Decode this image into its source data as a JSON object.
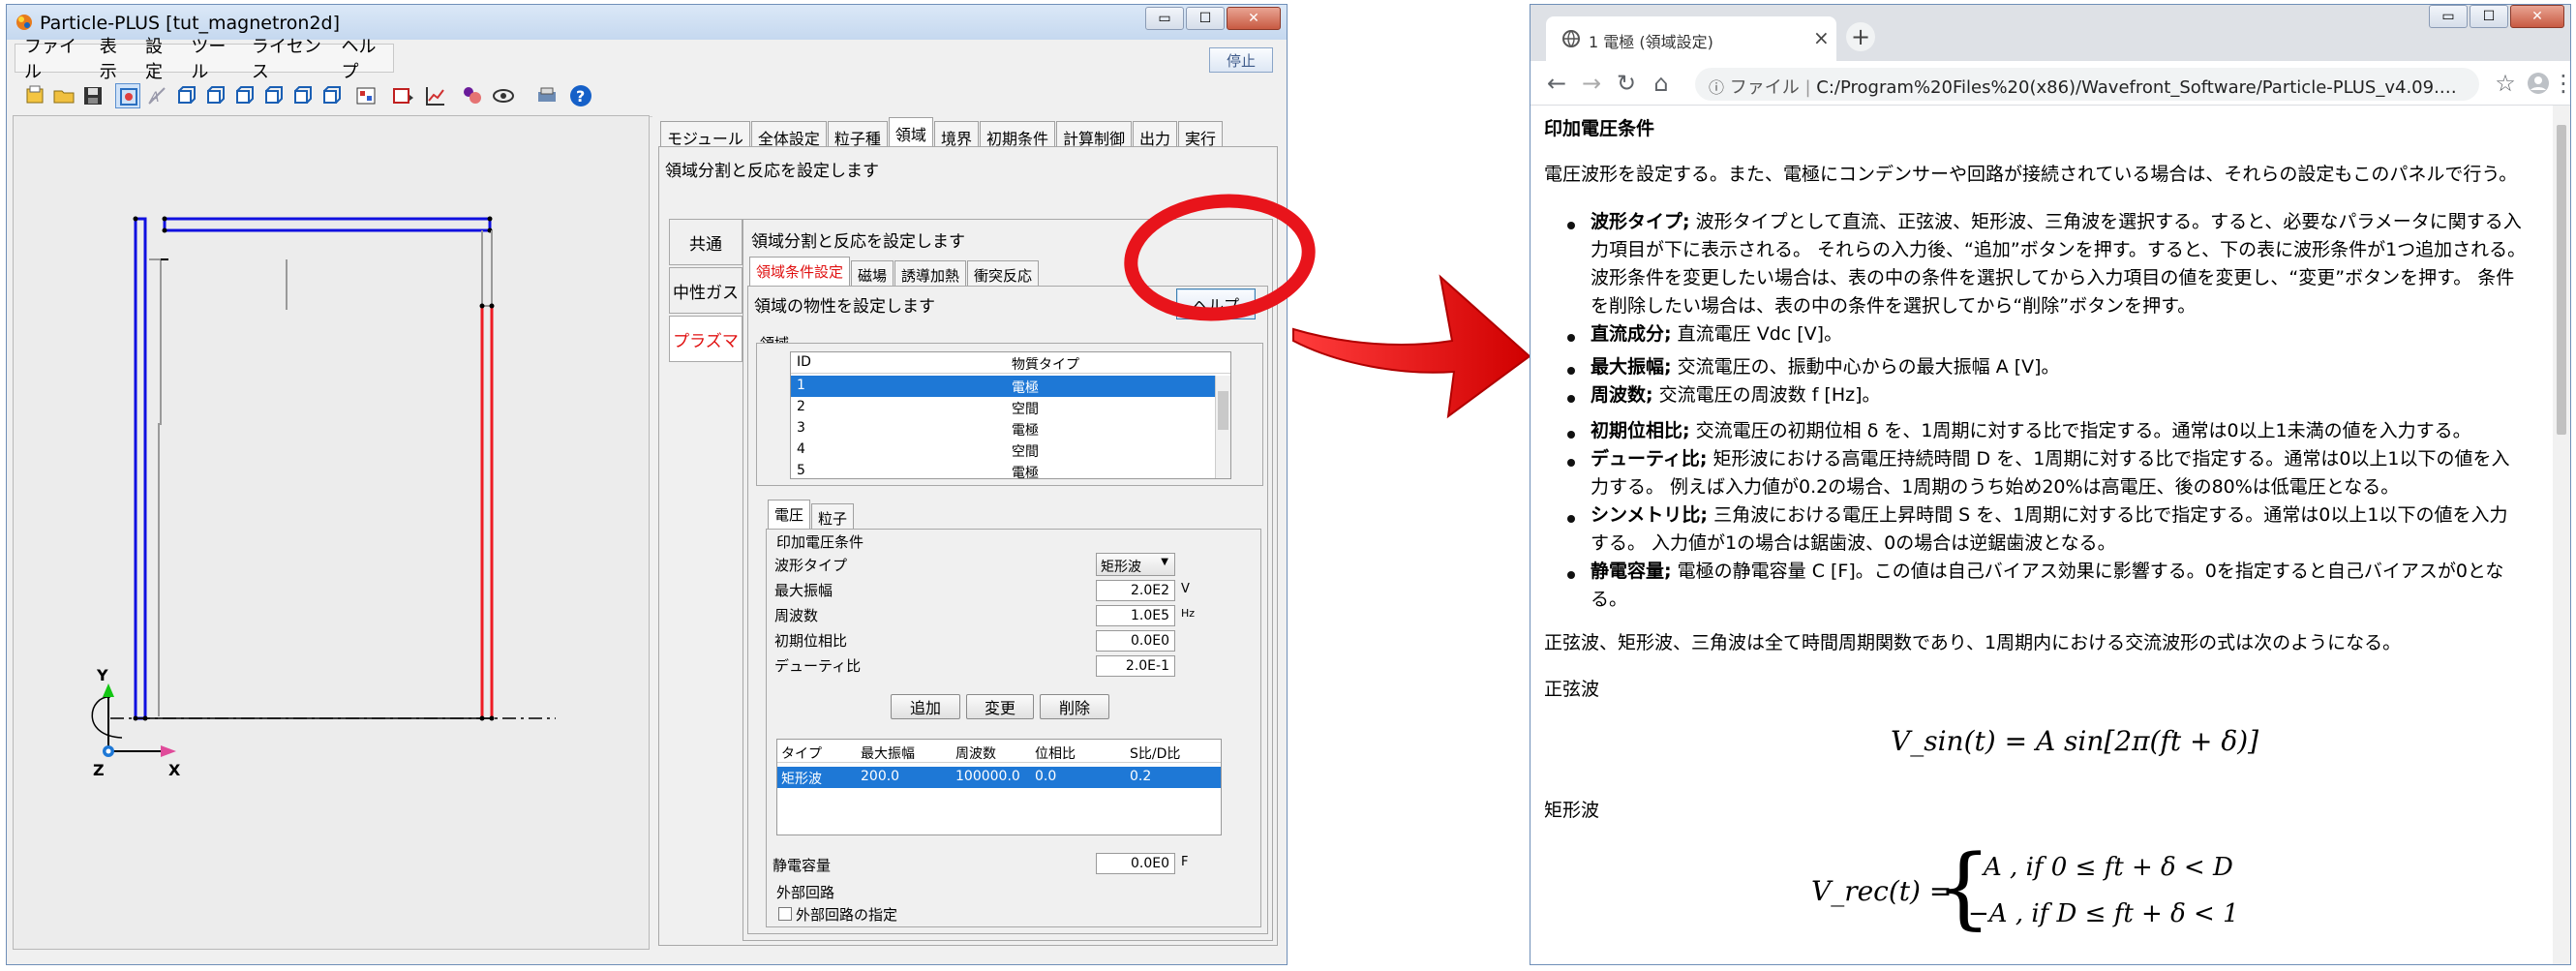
{
  "app": {
    "title": "Particle-PLUS [tut_magnetron2d]",
    "menu": [
      "ファイル",
      "表示",
      "設定",
      "ツール",
      "ライセンス",
      "ヘルプ"
    ],
    "stop_label": "停止",
    "main_tabs": [
      "モジュール",
      "全体設定",
      "粒子種",
      "領域",
      "境界",
      "初期条件",
      "計算制御",
      "出力",
      "実行"
    ],
    "main_heading": "領域分割と反応を設定します",
    "side_tabs": [
      "共通",
      "中性ガス",
      "プラズマ"
    ],
    "sub_heading": "領域分割と反応を設定します",
    "sub_tabs": [
      "領域条件設定",
      "磁場",
      "誘導加熱",
      "衝突反応"
    ],
    "property_heading": "領域の物性を設定します",
    "help_label": "ヘルプ",
    "region_group": "領域",
    "region_table": {
      "headers": [
        "ID",
        "物質タイプ"
      ],
      "rows": [
        [
          "1",
          "電極"
        ],
        [
          "2",
          "空間"
        ],
        [
          "3",
          "電極"
        ],
        [
          "4",
          "空間"
        ],
        [
          "5",
          "電極"
        ]
      ]
    },
    "inner_tabs": [
      "電圧",
      "粒子"
    ],
    "voltage_group": "印加電圧条件",
    "fields": [
      {
        "label": "波形タイプ",
        "value": "矩形波",
        "unit": ""
      },
      {
        "label": "最大振幅",
        "value": "2.0E2",
        "unit": "V"
      },
      {
        "label": "周波数",
        "value": "1.0E5",
        "unit": "Hz"
      },
      {
        "label": "初期位相比",
        "value": "0.0E0",
        "unit": ""
      },
      {
        "label": "デューティ比",
        "value": "2.0E-1",
        "unit": ""
      }
    ],
    "buttons": [
      "追加",
      "変更",
      "削除"
    ],
    "wave_table": {
      "headers": [
        "タイプ",
        "最大振幅",
        "周波数",
        "位相比",
        "S比/D比"
      ],
      "row": [
        "矩形波",
        "200.0",
        "100000.0",
        "0.0",
        "0.2"
      ]
    },
    "capacitance_label": "静電容量",
    "capacitance_value": "0.0E0",
    "capacitance_unit": "F",
    "ext_group": "外部回路",
    "ext_checkbox": "外部回路の指定",
    "axes": {
      "y": "Y",
      "z": "Z",
      "x": "X"
    }
  },
  "browser": {
    "tab_title": "1 電極 (領域設定)",
    "address_prefix": "ファイル",
    "address": "C:/Program%20Files%20(x86)/Wavefront_Software/Particle-PLUS_v4.09.…",
    "heading": "印加電圧条件",
    "intro": "電圧波形を設定する。また、電極にコンデンサーや回路が接続されている場合は、それらの設定もこのパネルで行う。",
    "items": [
      {
        "term": "波形タイプ;",
        "lines": [
          "波形タイプとして直流、正弦波、矩形波、三角波を選択する。すると、必要なパラメータに関する入",
          "力項目が下に表示される。 それらの入力後、“追加”ボタンを押す。すると、下の表に波形条件が1つ追加される。",
          "波形条件を変更したい場合は、表の中の条件を選択してから入力項目の値を変更し、“変更”ボタンを押す。 条件",
          "を削除したい場合は、表の中の条件を選択してから“削除”ボタンを押す。"
        ]
      },
      {
        "term": "直流成分;",
        "lines": [
          "直流電圧 Vdc [V]。"
        ]
      },
      {
        "term": "最大振幅;",
        "lines": [
          "交流電圧の、振動中心からの最大振幅 A [V]。"
        ]
      },
      {
        "term": "周波数;",
        "lines": [
          "交流電圧の周波数 f [Hz]。"
        ]
      },
      {
        "term": "初期位相比;",
        "lines": [
          "交流電圧の初期位相 δ を、1周期に対する比で指定する。通常は0以上1未満の値を入力する。"
        ]
      },
      {
        "term": "デューティ比;",
        "lines": [
          "矩形波における高電圧持続時間 D を、1周期に対する比で指定する。通常は0以上1以下の値を入",
          "力する。 例えば入力値が0.2の場合、1周期のうち始め20%は高電圧、後の80%は低電圧となる。"
        ]
      },
      {
        "term": "シンメトリ比;",
        "lines": [
          "三角波における電圧上昇時間 S を、1周期に対する比で指定する。通常は0以上1以下の値を入力",
          "する。 入力値が1の場合は鋸歯波、0の場合は逆鋸歯波となる。"
        ]
      },
      {
        "term": "静電容量;",
        "lines": [
          "電極の静電容量 C [F]。この値は自己バイアス効果に影響する。0を指定すると自己バイアスが0とな",
          "る。"
        ]
      }
    ],
    "periodic": "正弦波、矩形波、三角波は全て時間周期関数であり、1周期内における交流波形の式は次のようになる。",
    "sine_label": "正弦波",
    "sine_eq": "V_sin(t) = A sin[2π(ft + δ)]",
    "rect_label": "矩形波",
    "rect_eq": {
      "lhs": "V_rec(t) =",
      "case1": "A   ,   if   0 ≤ ft + δ < D",
      "case2": "−A   ,   if   D ≤ ft + δ < 1"
    }
  },
  "colors": {
    "callout_red": "#e8141b",
    "accent_blue": "#1e78d6",
    "electrode_red": "#ee1c24",
    "electrode_blue": "#1010e0"
  }
}
